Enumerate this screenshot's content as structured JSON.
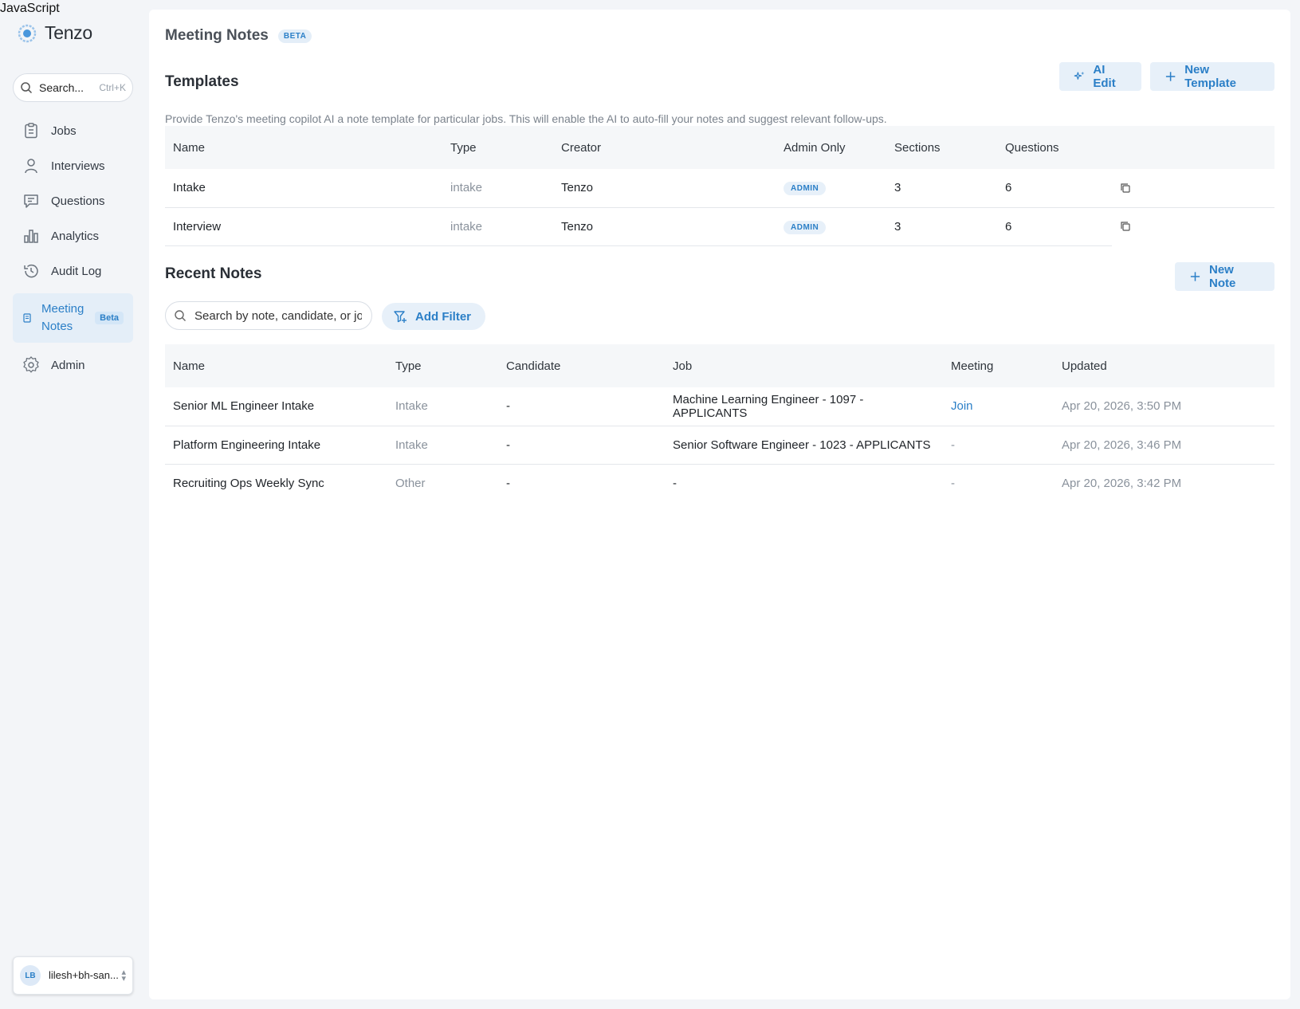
{
  "overlay_text": "JavaScript",
  "sidebar": {
    "brand": "Tenzo",
    "search": {
      "label": "Search...",
      "shortcut": "Ctrl+K"
    },
    "items": [
      {
        "label": "Jobs",
        "icon": "clipboard-icon"
      },
      {
        "label": "Interviews",
        "icon": "person-icon"
      },
      {
        "label": "Questions",
        "icon": "chat-icon"
      },
      {
        "label": "Analytics",
        "icon": "bar-chart-icon"
      },
      {
        "label": "Audit Log",
        "icon": "history-icon"
      },
      {
        "label": "Meeting Notes",
        "icon": "document-icon",
        "badge": "Beta",
        "active": true
      },
      {
        "label": "Admin",
        "icon": "gear-icon"
      }
    ],
    "user": {
      "initials": "LB",
      "name": "lilesh+bh-san..."
    }
  },
  "page": {
    "title": "Meeting Notes",
    "badge": "BETA"
  },
  "templates": {
    "title": "Templates",
    "ai_edit_label": "AI Edit",
    "new_template_label": "New Template",
    "description": "Provide Tenzo's meeting copilot AI a note template for particular jobs. This will enable the AI to auto-fill your notes and suggest relevant follow-ups.",
    "columns": [
      "Name",
      "Type",
      "Creator",
      "Admin Only",
      "Sections",
      "Questions"
    ],
    "rows": [
      {
        "name": "Intake",
        "type": "intake",
        "creator": "Tenzo",
        "admin_only": "ADMIN",
        "sections": "3",
        "questions": "6"
      },
      {
        "name": "Interview",
        "type": "intake",
        "creator": "Tenzo",
        "admin_only": "ADMIN",
        "sections": "3",
        "questions": "6"
      }
    ]
  },
  "recent_notes": {
    "title": "Recent Notes",
    "new_note_label": "New Note",
    "search_placeholder": "Search by note, candidate, or job",
    "add_filter_label": "Add Filter",
    "columns": [
      "Name",
      "Type",
      "Candidate",
      "Job",
      "Meeting",
      "Updated"
    ],
    "rows": [
      {
        "name": "Senior ML Engineer Intake",
        "type": "Intake",
        "candidate": "-",
        "job": "Machine Learning Engineer - 1097 - APPLICANTS",
        "meeting": "Join",
        "updated": "Apr 20, 2026, 3:50 PM"
      },
      {
        "name": "Platform Engineering Intake",
        "type": "Intake",
        "candidate": "-",
        "job": "Senior Software Engineer - 1023 - APPLICANTS",
        "meeting": "-",
        "updated": "Apr 20, 2026, 3:46 PM"
      },
      {
        "name": "Recruiting Ops Weekly Sync",
        "type": "Other",
        "candidate": "-",
        "job": "-",
        "meeting": "-",
        "updated": "Apr 20, 2026, 3:42 PM"
      }
    ]
  },
  "colors": {
    "accent": "#2b7fc7",
    "accent_bg": "#e7f0f9",
    "page_bg": "#f3f5f8"
  }
}
